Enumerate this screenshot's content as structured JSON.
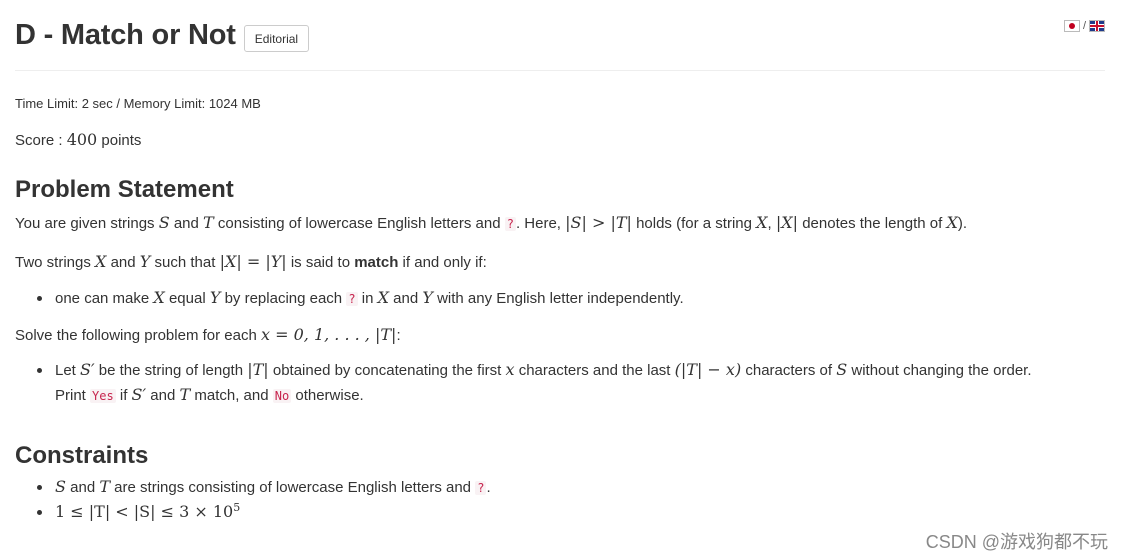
{
  "header": {
    "title": "D - Match or Not",
    "editorial_label": "Editorial",
    "lang_separator": "/"
  },
  "limits": "Time Limit: 2 sec / Memory Limit: 1024 MB",
  "score": {
    "prefix": "Score : ",
    "value": "400",
    "suffix": " points"
  },
  "statement": {
    "heading": "Problem Statement",
    "p1": {
      "t1": "You are given strings ",
      "S": "S",
      "t2": " and ",
      "T": "T",
      "t3": " consisting of lowercase English letters and ",
      "q": "?",
      "t4": ". Here, ",
      "m1": "|S| > |T|",
      "t5": " holds (for a string ",
      "X": "X",
      "t6": ", ",
      "m2": "|X|",
      "t7": " denotes the length of ",
      "X2": "X",
      "t8": ")."
    },
    "p2": {
      "t1": "Two strings ",
      "X": "X",
      "t2": " and ",
      "Y": "Y",
      "t3": " such that ",
      "m1": "|X| = |Y|",
      "t4": " is said to ",
      "bold": "match",
      "t5": " if and only if:"
    },
    "li1": {
      "t1": "one can make ",
      "X": "X",
      "t2": " equal ",
      "Y": "Y",
      "t3": " by replacing each ",
      "q": "?",
      "t4": " in ",
      "X2": "X",
      "t5": " and ",
      "Y2": "Y",
      "t6": " with any English letter independently."
    },
    "p3": {
      "t1": "Solve the following problem for each ",
      "m1": "x = 0, 1, . . . , |T|",
      "t2": ":"
    },
    "li2": {
      "t1": "Let ",
      "Sp": "S′",
      "t2": " be the string of length ",
      "m1": "|T|",
      "t3": " obtained by concatenating the first ",
      "x": "x",
      "t4": " characters and the last ",
      "m2": "(|T| − x)",
      "t5": " characters of ",
      "S": "S",
      "t6": " without changing the order."
    },
    "li2b": {
      "t1": "Print ",
      "yes": "Yes",
      "t2": " if ",
      "Sp": "S′",
      "t3": " and ",
      "T": "T",
      "t4": " match, and ",
      "no": "No",
      "t5": " otherwise."
    }
  },
  "constraints": {
    "heading": "Constraints",
    "c1": {
      "S": "S",
      "t1": " and ",
      "T": "T",
      "t2": " are strings consisting of lowercase English letters and ",
      "q": "?",
      "t3": "."
    },
    "c2": {
      "m1": "1 ≤ |T| < |S| ≤ 3 × 10",
      "exp": "5"
    }
  },
  "watermark": "CSDN @游戏狗都不玩"
}
